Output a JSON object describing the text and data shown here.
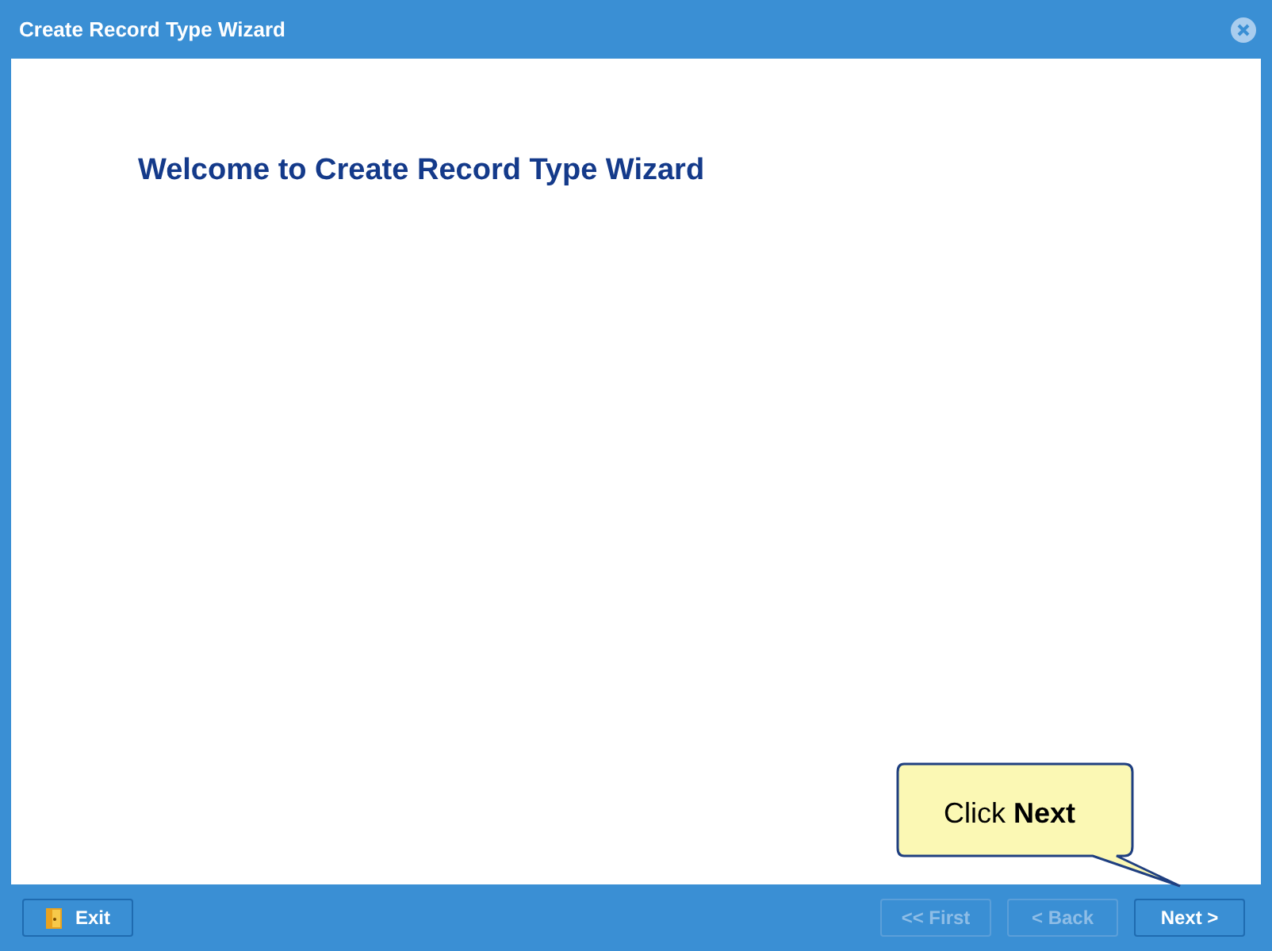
{
  "window": {
    "title": "Create Record Type Wizard"
  },
  "heading": "Welcome to Create Record Type Wizard",
  "callout": {
    "text": "Click **Next**"
  },
  "footer": {
    "exit": {
      "label": "Exit",
      "disabled": false
    },
    "nav": [
      {
        "label": "<< First",
        "disabled": true
      },
      {
        "label": "< Back",
        "disabled": true
      },
      {
        "label": "Next >",
        "disabled": false
      }
    ]
  }
}
